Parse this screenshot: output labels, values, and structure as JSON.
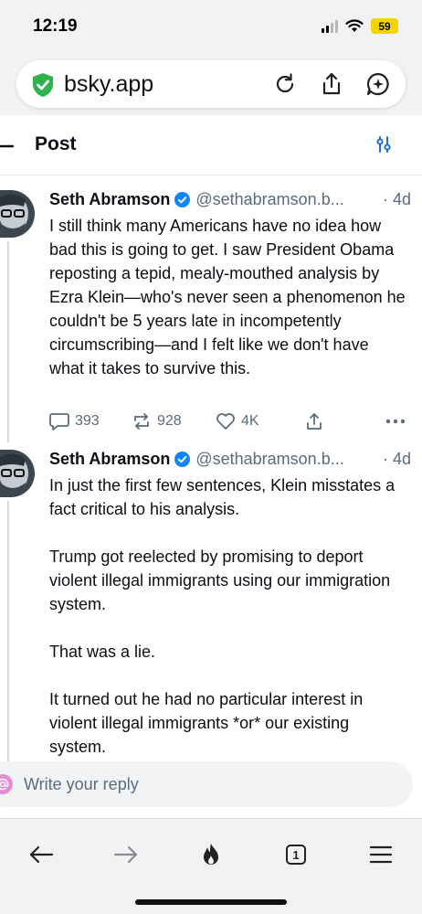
{
  "status_bar": {
    "time": "12:19",
    "battery": "59"
  },
  "browser": {
    "url": "bsky.app",
    "icons": [
      "shield-check-icon",
      "reload-icon",
      "share-icon",
      "ai-chat-icon"
    ]
  },
  "header": {
    "title": "Post"
  },
  "posts": [
    {
      "author": "Seth Abramson",
      "handle": "@sethabramson.b...",
      "time": "· 4d",
      "text": "I still think many Americans have no idea how bad this is going to get. I saw President Obama reposting a tepid, mealy-mouthed analysis by Ezra Klein—who's never seen a phenomenon he couldn't be 5 years late in incompetently circumscribing—and I felt like we don't have what it takes to survive this.",
      "replies": "393",
      "reposts": "928",
      "likes": "4K"
    },
    {
      "author": "Seth Abramson",
      "handle": "@sethabramson.b...",
      "time": "· 4d",
      "text": "In just the first few sentences, Klein misstates a fact critical to his analysis.\n\nTrump got reelected by promising to deport violent illegal immigrants using our immigration system.\n\nThat was a lie.\n\nIt turned out he had no particular interest in violent illegal immigrants *or* our existing system."
    }
  ],
  "reply": {
    "placeholder": "Write your reply"
  },
  "toolbar": {
    "tabs_count": "1"
  },
  "colors": {
    "accent": "#1185fe",
    "muted": "#5a6b7d",
    "battery": "#f4d500"
  }
}
